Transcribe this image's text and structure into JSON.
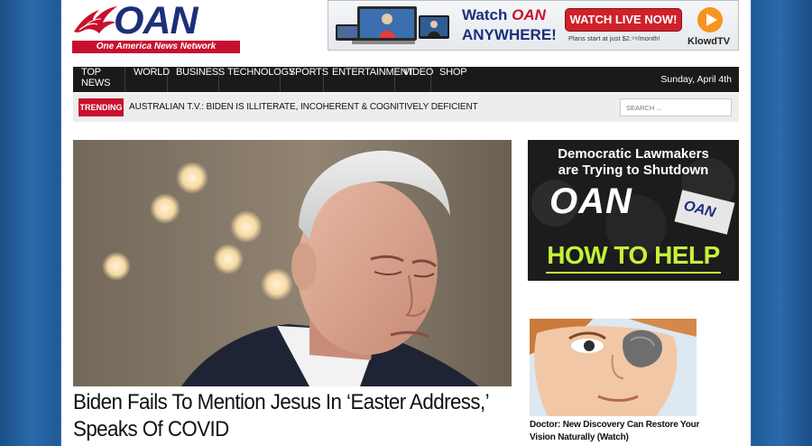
{
  "header": {
    "logo_text": "OAN",
    "logo_subtitle": "One America News Network"
  },
  "ad_banner": {
    "watch_label": "Watch",
    "watch_brand": "OAN",
    "anywhere_label": "ANYWHERE!",
    "cta_label": "WATCH LIVE NOW!",
    "price_text": "Plans start at just $2.⁹⁹/month!",
    "partner_label": "KlowdTV"
  },
  "nav": {
    "items": [
      "TOP NEWS",
      "WORLD",
      "BUSINESS",
      "TECHNOLOGY",
      "SPORTS",
      "ENTERTAINMENT",
      "VIDEO",
      "SHOP"
    ],
    "date": "Sunday, April 4th"
  },
  "trending": {
    "label": "TRENDING",
    "headline": "AUSTRALIAN T.V.: BIDEN IS ILLITERATE, INCOHERENT & COGNITIVELY DEFICIENT"
  },
  "search": {
    "placeholder": "SEARCH ..."
  },
  "hero": {
    "headline": "Biden Fails To Mention Jesus In ‘Easter Address,’ Speaks Of COVID"
  },
  "sidebar_ad": {
    "line1": "Democratic Lawmakers",
    "line2": "are Trying to Shutdown",
    "logo": "OAN",
    "sign_text": "OAN",
    "cta": "HOW TO HELP"
  },
  "promo": {
    "text": "Doctor: New Discovery Can Restore Your Vision Naturally (Watch)"
  },
  "colors": {
    "brand_red": "#c8102e",
    "brand_navy": "#1b2f7a",
    "nav_bg": "#1a1a1a",
    "accent_green": "#c7f03a"
  }
}
